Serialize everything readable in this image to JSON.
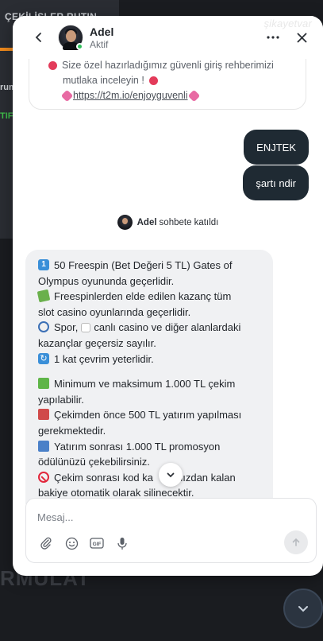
{
  "background": {
    "title": "ÇEKİLİŞLER RUTIN",
    "row1": "rum",
    "row2": "TIF",
    "bottom_text": "RMULAT",
    "watermark": "şikayetvar"
  },
  "chat": {
    "agent_name": "Adel",
    "agent_status": "Aktif",
    "icons": {
      "back": "chevron-left-icon",
      "more": "more-horizontal-icon",
      "close": "close-icon"
    },
    "top_message": {
      "line1": "Size özel hazırladığımız güvenli giriş rehberimizi",
      "line2": "mutlaka inceleyin !",
      "link": "https://t2m.io/enjoyguvenli"
    },
    "user_messages": [
      {
        "text": "ENJTEK"
      },
      {
        "text": "şartı ndir"
      }
    ],
    "joined_notice": {
      "name": "Adel",
      "text": "sohbete katıldı"
    },
    "agent_message": {
      "lines": [
        "50 Freespin (Bet Değeri 5 TL) Gates of",
        "Olympus oyununda geçerlidir.",
        "Freespinlerden elde edilen kazanç tüm",
        "slot casino oyunlarında geçerlidir.",
        "Spor,",
        "canlı casino ve diğer alanlardaki",
        "kazançlar geçersiz sayılır.",
        "1 kat çevrim yeterlidir.",
        "Minimum ve maksimum 1.000 TL çekim",
        "yapılabilir.",
        "Çekimden önce 500 TL yatırım yapılması",
        "gerekmektedir.",
        "Yatırım sonrası 1.000 TL promosyon",
        "ödülünüzü çekebilirsiniz.",
        "Çekim sonrası kod ka",
        "nızdan kalan",
        "bakiye otomatik olarak silinecektir."
      ]
    },
    "composer": {
      "placeholder": "Mesaj...",
      "tools": [
        "paperclip-icon",
        "emoji-icon",
        "gif-icon",
        "microphone-icon"
      ],
      "send_icon": "send-arrow-icon"
    }
  },
  "colors": {
    "user_bubble": "#1f2a33",
    "agent_bubble": "#f0f1f3",
    "online": "#2fbf5b",
    "accent_orange": "#f08a1c"
  }
}
